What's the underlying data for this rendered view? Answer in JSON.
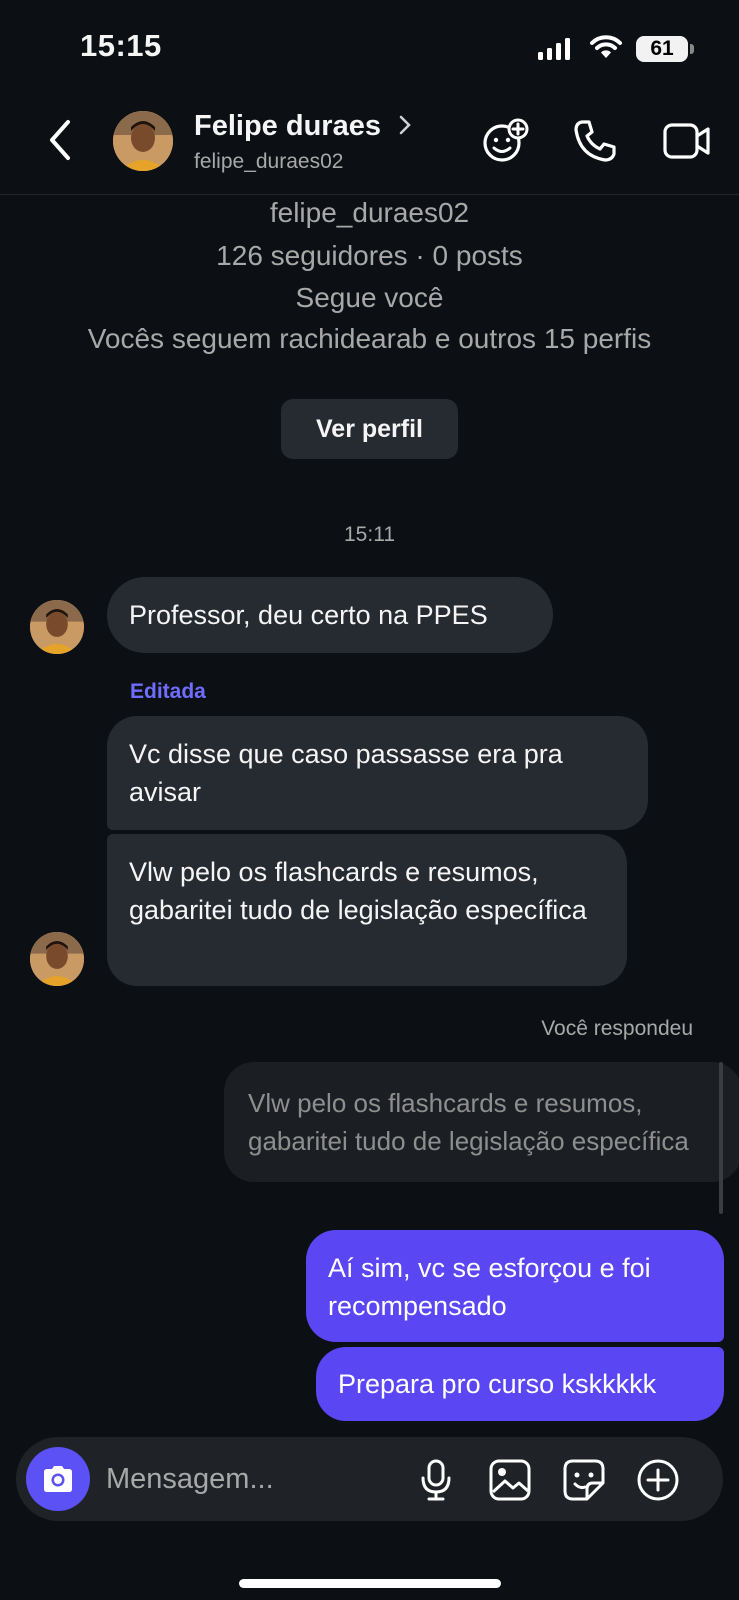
{
  "status_bar": {
    "time": "15:15",
    "battery": "61"
  },
  "header": {
    "back_icon": "chevron-left-icon",
    "name": "Felipe duraes",
    "username": "felipe_duraes02",
    "actions": [
      "add-reaction-icon",
      "phone-icon",
      "video-camera-icon"
    ]
  },
  "profile_summary": {
    "username": "felipe_duraes02",
    "stats": "126 seguidores · 0 posts",
    "follows_you": "Segue você",
    "mutuals": "Vocês seguem rachidearab e outros 15 perfis",
    "view_profile_label": "Ver perfil"
  },
  "conversation": {
    "timestamp": "15:11",
    "edited_label": "Editada",
    "incoming": [
      "Professor, deu certo na PPES",
      "Vc disse que caso passasse era pra avisar",
      "Vlw pelo os flashcards e resumos, gabaritei tudo de legislação específica"
    ],
    "reply_label": "Você respondeu",
    "quoted": "Vlw pelo os flashcards e resumos, gabaritei tudo de legislação específica",
    "outgoing": [
      "Aí sim, vc se esforçou e foi recompensado",
      "Prepara pro curso kskkkkk"
    ]
  },
  "composer": {
    "placeholder": "Mensagem...",
    "icons": [
      "camera-icon",
      "microphone-icon",
      "gallery-icon",
      "sticker-icon",
      "plus-icon"
    ]
  },
  "colors": {
    "background": "#0c1014",
    "incoming_bubble": "#262a31",
    "outgoing_bubble": "#5b46f4",
    "accent": "#6f6dff",
    "muted_text": "#a8a8a8"
  }
}
